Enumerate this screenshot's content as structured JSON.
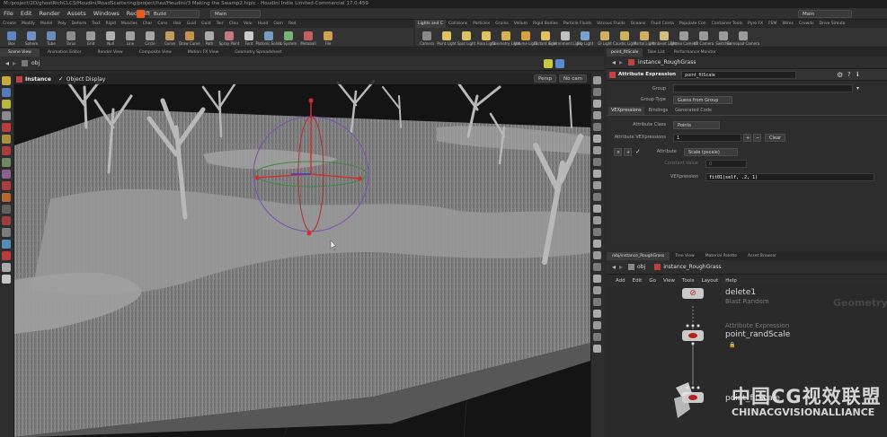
{
  "window": {
    "title": "M:/project/2D/ghostRichCLCS/Houdini/RoadScattering/project/hez/Houdini/3 Making the Swamp2.hiplc - Houdini Indie Limited-Commercial 17.0.459"
  },
  "menu": {
    "items": [
      "File",
      "Edit",
      "Render",
      "Assets",
      "Windows",
      "Redshift",
      "Help"
    ],
    "desktop": "Build",
    "context": "Main",
    "right_context": "Main"
  },
  "shelf_left": {
    "tabs": [
      "Create",
      "Modify",
      "Model",
      "Poly",
      "Deform",
      "Text",
      "Rigid",
      "Muscles",
      "Char",
      "Cons",
      "Hair",
      "Guid",
      "Guid",
      "Terr",
      "Clou",
      "Volu",
      "Hood",
      "Gam",
      "Red"
    ],
    "tools": [
      {
        "label": "Box",
        "color": "#5f86c0"
      },
      {
        "label": "Sphere",
        "color": "#6f8fc6"
      },
      {
        "label": "Tube",
        "color": "#6e8ab8"
      },
      {
        "label": "Torus",
        "color": "#8c8c8c"
      },
      {
        "label": "Grid",
        "color": "#9a9a9a"
      },
      {
        "label": "Null",
        "color": "#b0b0b0"
      },
      {
        "label": "Line",
        "color": "#a0a0a0"
      },
      {
        "label": "Circle",
        "color": "#a6a6a6"
      },
      {
        "label": "Curve",
        "color": "#c49a60"
      },
      {
        "label": "Draw Curve",
        "color": "#c6904e"
      },
      {
        "label": "Path",
        "color": "#aaaaaa"
      },
      {
        "label": "Spray Paint",
        "color": "#c07a7a"
      },
      {
        "label": "Font",
        "color": "#cccccc"
      },
      {
        "label": "Platonic Solids",
        "color": "#7a9ac0"
      },
      {
        "label": "L-System",
        "color": "#7ab07a"
      },
      {
        "label": "Metaball",
        "color": "#c06060"
      },
      {
        "label": "File",
        "color": "#d0a050"
      }
    ]
  },
  "shelf_right": {
    "tabs": [
      "Lights and C",
      "Collisions",
      "Particles",
      "Grains",
      "Vellum",
      "Rigid Bodies",
      "Particle Fluids",
      "Viscous Fluids",
      "Oceans",
      "Fluid Conta",
      "Populate Con",
      "Container Tools",
      "Pyro FX",
      "FEM",
      "Wires",
      "Crowds",
      "Drive Simula"
    ],
    "tools": [
      {
        "label": "Camera",
        "color": "#8a8a8a"
      },
      {
        "label": "Point Light",
        "color": "#e0c060"
      },
      {
        "label": "Spot Light",
        "color": "#e0c060"
      },
      {
        "label": "Area Light",
        "color": "#e0c060"
      },
      {
        "label": "Geometry Light",
        "color": "#d8b050"
      },
      {
        "label": "Volume Light",
        "color": "#d8a040"
      },
      {
        "label": "Distant Light",
        "color": "#e0c060"
      },
      {
        "label": "Environment Light",
        "color": "#c0c0c0"
      },
      {
        "label": "Sky Light",
        "color": "#7aa0d0"
      },
      {
        "label": "GI Light",
        "color": "#d0b060"
      },
      {
        "label": "Caustic Light",
        "color": "#d0b060"
      },
      {
        "label": "Portal Light",
        "color": "#d0b060"
      },
      {
        "label": "Ambient Light",
        "color": "#d0c080"
      },
      {
        "label": "Stereo Camera",
        "color": "#9a9a9a"
      },
      {
        "label": "VR Camera",
        "color": "#9a9a9a"
      },
      {
        "label": "Switcher",
        "color": "#9a9a9a"
      },
      {
        "label": "Gamepad Camera",
        "color": "#9a9a9a"
      }
    ]
  },
  "left_pane_tabs": [
    "Scene View",
    "Animation Editor",
    "Render View",
    "Composite View",
    "Motion FX View",
    "Geometry Spreadsheet"
  ],
  "viewport": {
    "path": "obj",
    "node_type": "Instance",
    "display_mode": "Object Display",
    "view_menu": "Persp",
    "camera_menu": "No cam"
  },
  "param_pane": {
    "tabs": [
      "point_fitScale",
      "Take List",
      "Performance Monitor"
    ],
    "path": "instance_RoughGrass",
    "node_type": "Attribute Expression",
    "node_name": "point_fitScale",
    "group_label": "Group",
    "group_value": "",
    "group_type_label": "Group Type",
    "group_type_value": "Guess from Group",
    "sub_tabs": [
      "VEXpressions",
      "Bindings",
      "Generated Code"
    ],
    "attr_class_label": "Attribute Class",
    "attr_class_value": "Points",
    "vexpr_label": "Attribute VEXpressions",
    "vexpr_count": "1",
    "clear_label": "Clear",
    "attribute_label": "Attribute",
    "attribute_value": "Scale (pscale)",
    "constant_label": "Constant Value",
    "constant_value": "0",
    "vexpression_label": "VEXpression",
    "vexpression_value": "fit01(self, .2, 1)"
  },
  "network_pane": {
    "tabs": [
      "/obj/instance_RoughGrass",
      "Tree View",
      "Material Palette",
      "Asset Browser"
    ],
    "path_root": "obj",
    "path_node": "instance_RoughGrass",
    "menu": [
      "Add",
      "Edit",
      "Go",
      "View",
      "Tools",
      "Layout",
      "Help"
    ],
    "watermark": "Geometry",
    "nodes": [
      {
        "name": "delete1",
        "sub": "Blast Random"
      },
      {
        "name": "point_randScale",
        "sub": "Attribute Expression"
      },
      {
        "name": "point_fitScale",
        "sub": ""
      }
    ]
  },
  "logo": {
    "cn": "中国CG视效联盟",
    "en": "CHINACGVISIONALLIANCE"
  }
}
